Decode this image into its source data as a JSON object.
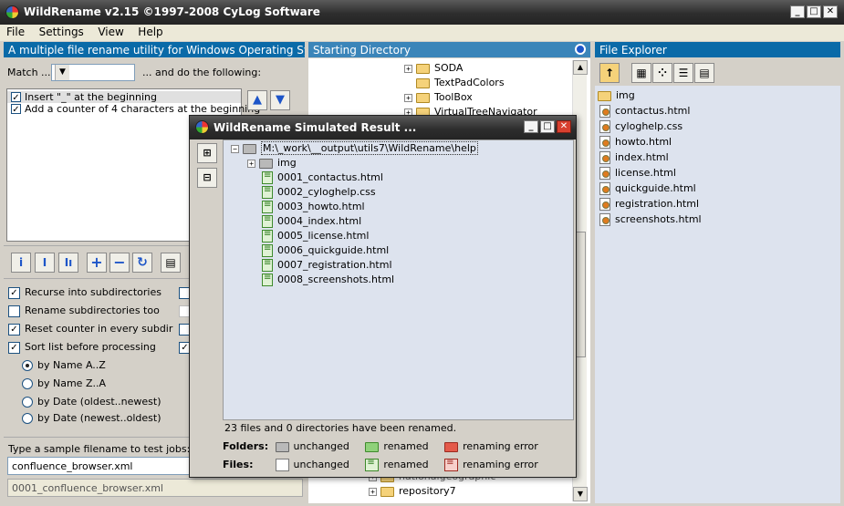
{
  "window": {
    "title": "WildRename v2.15 ©1997-2008 CyLog Software",
    "controls": {
      "minimize": "_",
      "maximize": "□",
      "close": "✕"
    }
  },
  "menu": [
    "File",
    "Settings",
    "View",
    "Help"
  ],
  "left_panel": {
    "header": "A multiple file rename utility for Windows Operating Systems",
    "match_label": "Match ...",
    "match_value": "*.*",
    "and_do_label": "... and do the following:",
    "jobs": [
      {
        "label": "Insert \"_\" at the beginning",
        "checked": true,
        "selected": true
      },
      {
        "label": "Add a counter of 4 characters at the beginning",
        "checked": true,
        "selected": false
      }
    ],
    "move_up": "▲",
    "move_down": "▼",
    "toolbar_icons": [
      "info-icon",
      "insert-icon",
      "multi-insert-icon",
      "add-icon",
      "remove-icon",
      "refresh-icon",
      "list-icon"
    ],
    "toolbar_glyphs": {
      "info": "i",
      "insert": "I",
      "multi": "Iı",
      "add": "+",
      "remove": "−",
      "refresh": "↻",
      "list": "▤"
    },
    "options": [
      {
        "label": "Recurse into subdirectories",
        "checked": true
      },
      {
        "label": "Rename subdirectories too",
        "checked": false
      },
      {
        "label": "Reset counter in every subdir",
        "checked": true
      },
      {
        "label": "Sort list before processing",
        "checked": true
      }
    ],
    "sort_options": [
      {
        "label": "by Name A..Z",
        "selected": true
      },
      {
        "label": "by Name Z..A",
        "selected": false
      },
      {
        "label": "by Date (oldest..newest)",
        "selected": false
      },
      {
        "label": "by Date (newest..oldest)",
        "selected": false
      }
    ],
    "sample_label": "Type a sample filename to test jobs:",
    "sample_input": "confluence_browser.xml",
    "sample_result": "0001_confluence_browser.xml"
  },
  "mid_panel": {
    "header": "Starting Directory",
    "tree_top": [
      {
        "label": "SODA",
        "expander": "+"
      },
      {
        "label": "TextPadColors",
        "expander": ""
      },
      {
        "label": "ToolBox",
        "expander": "+"
      },
      {
        "label": "VirtualTreeNavigator",
        "expander": "+"
      }
    ],
    "tree_bottom": [
      {
        "label": "nationalgeographic",
        "expander": "+"
      },
      {
        "label": "repository7",
        "expander": "+"
      }
    ]
  },
  "right_panel": {
    "header": "File Explorer",
    "items": [
      {
        "label": "img",
        "type": "folder"
      },
      {
        "label": "contactus.html",
        "type": "web"
      },
      {
        "label": "cyloghelp.css",
        "type": "css"
      },
      {
        "label": "howto.html",
        "type": "web"
      },
      {
        "label": "index.html",
        "type": "web"
      },
      {
        "label": "license.html",
        "type": "web"
      },
      {
        "label": "quickguide.html",
        "type": "web"
      },
      {
        "label": "registration.html",
        "type": "web"
      },
      {
        "label": "screenshots.html",
        "type": "web"
      }
    ]
  },
  "dialog": {
    "title": "WildRename Simulated Result ...",
    "root": "M:\\_work\\__output\\utils7\\WildRename\\help",
    "root_expander": "−",
    "img_expander": "+",
    "items": [
      {
        "label": "img",
        "type": "folder-unchanged"
      },
      {
        "label": "0001_contactus.html",
        "type": "file-renamed"
      },
      {
        "label": "0002_cyloghelp.css",
        "type": "file-renamed"
      },
      {
        "label": "0003_howto.html",
        "type": "file-renamed"
      },
      {
        "label": "0004_index.html",
        "type": "file-renamed"
      },
      {
        "label": "0005_license.html",
        "type": "file-renamed"
      },
      {
        "label": "0006_quickguide.html",
        "type": "file-renamed"
      },
      {
        "label": "0007_registration.html",
        "type": "file-renamed"
      },
      {
        "label": "0008_screenshots.html",
        "type": "file-renamed"
      }
    ],
    "status": "23 files and 0 directories have been renamed.",
    "legend": {
      "folders_label": "Folders:",
      "files_label": "Files:",
      "unchanged": "unchanged",
      "renamed": "renamed",
      "error": "renaming error"
    }
  },
  "colors": {
    "panel_header": "#0a6aa8",
    "titlebar": "#2e2e2e",
    "renamed_green": "#8fd17a",
    "error_red": "#e45a4a"
  }
}
